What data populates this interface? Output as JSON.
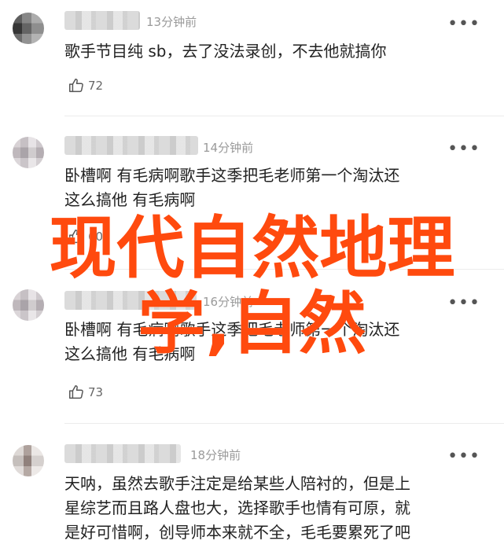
{
  "comments": [
    {
      "time": "13分钟前",
      "text": "歌手节目纯 sb，去了没法录创，不去他就搞你",
      "likes": "72"
    },
    {
      "time": "14分钟前",
      "text": "卧槽啊 有毛病啊歌手这季把毛老师第一个淘汰还\n这么搞他 有毛病啊",
      "likes": "60"
    },
    {
      "time": "16分钟前",
      "text": "卧槽啊 有毛病啊歌手这季把毛老师第一个淘汰还\n这么搞他 有毛病啊",
      "likes": "73"
    },
    {
      "time": "18分钟前",
      "text": "天呐，虽然去歌手注定是给某些人陪衬的，但是上\n星综艺而且路人盘也大，选择歌手也情有可原，就\n是好可惜啊，创导师本来就不全，毛毛要累死了吧",
      "likes": ""
    }
  ],
  "overlay": {
    "line1": "现代自然地理",
    "line2": "学,自然"
  },
  "icons": {
    "more": "more-dots-icon",
    "like": "thumbs-up-icon"
  },
  "colors": {
    "overlay": "#ff4a0e",
    "time": "#9a9a9a"
  }
}
